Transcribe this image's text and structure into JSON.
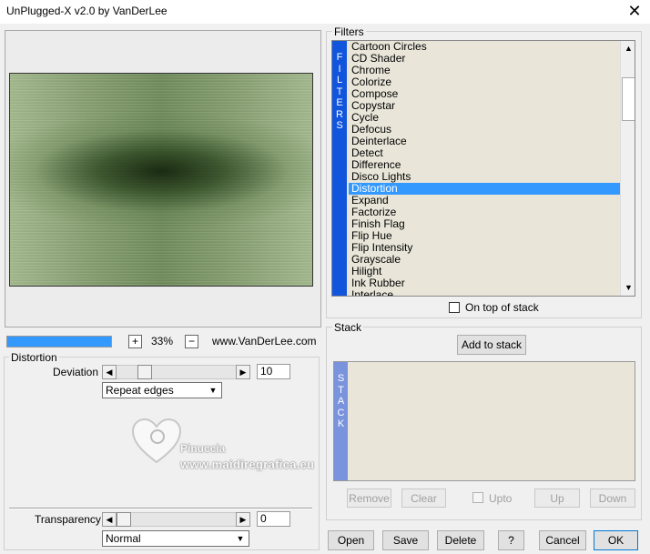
{
  "window": {
    "title": "UnPlugged-X v2.0 by VanDerLee",
    "close_glyph": "✕"
  },
  "preview": {
    "progress_fraction": 1.0,
    "zoom_in": "+",
    "zoom_out": "−",
    "zoom_level": "33%",
    "website": "www.VanDerLee.com"
  },
  "distortion_group": {
    "label": "Distortion",
    "deviation": {
      "label": "Deviation",
      "value": "10",
      "fraction": 0.2
    },
    "edge_mode": {
      "selected": "Repeat edges"
    },
    "transparency": {
      "label": "Transparency",
      "value": "0",
      "fraction": 0.0
    },
    "blend_mode": {
      "selected": "Normal"
    }
  },
  "filters": {
    "label": "Filters",
    "strip_letters": [
      "F",
      "I",
      "L",
      "T",
      "E",
      "R",
      "S"
    ],
    "items": [
      "Cartoon Circles",
      "CD Shader",
      "Chrome",
      "Colorize",
      "Compose",
      "Copystar",
      "Cycle",
      "Defocus",
      "Deinterlace",
      "Detect",
      "Difference",
      "Disco Lights",
      "Distortion",
      "Expand",
      "Factorize",
      "Finish Flag",
      "Flip Hue",
      "Flip Intensity",
      "Grayscale",
      "Hilight",
      "Ink Rubber",
      "Interlace"
    ],
    "selected_index": 12,
    "on_top_label": "On top of stack"
  },
  "stack": {
    "label": "Stack",
    "add_label": "Add to stack",
    "strip_letters": [
      "S",
      "T",
      "A",
      "C",
      "K"
    ],
    "remove_label": "Remove",
    "clear_label": "Clear",
    "upto_label": "Upto",
    "up_label": "Up",
    "down_label": "Down"
  },
  "footer": {
    "open": "Open",
    "save": "Save",
    "delete": "Delete",
    "help": "?",
    "cancel": "Cancel",
    "ok": "OK"
  },
  "watermark": {
    "line1": "Pinuccia",
    "line2": "www.maidiregrafica.eu"
  },
  "colors": {
    "accent": "#3399ff",
    "filter_strip": "#1155dd",
    "stack_strip": "#7a93dd",
    "list_bg": "#e9e6d9"
  },
  "icons": {
    "arrow_left": "◀",
    "arrow_right": "▶",
    "arrow_up": "▲",
    "arrow_down": "▼"
  }
}
